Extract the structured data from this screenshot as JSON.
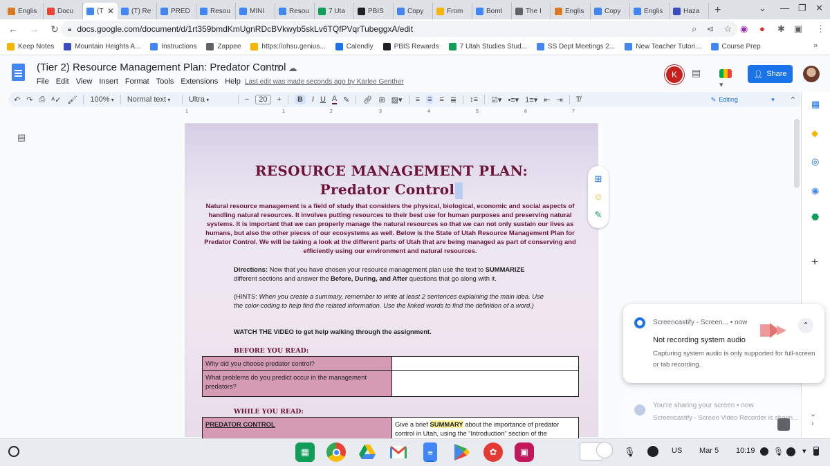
{
  "tabs": [
    {
      "label": "Englis",
      "color": "#d87a28"
    },
    {
      "label": "Docu",
      "color": "#ea4335"
    },
    {
      "label": "(T",
      "color": "#4285f4",
      "active": true
    },
    {
      "label": "(T) Re",
      "color": "#4285f4"
    },
    {
      "label": "PRED",
      "color": "#4285f4"
    },
    {
      "label": "Resou",
      "color": "#4285f4"
    },
    {
      "label": "MINI",
      "color": "#4285f4"
    },
    {
      "label": "Resou",
      "color": "#4285f4"
    },
    {
      "label": "7 Uta",
      "color": "#0f9d58"
    },
    {
      "label": "PBIS",
      "color": "#202124"
    },
    {
      "label": "Copy",
      "color": "#4285f4"
    },
    {
      "label": "From",
      "color": "#f4b400"
    },
    {
      "label": "Bomt",
      "color": "#4285f4"
    },
    {
      "label": "The I",
      "color": "#5f6368"
    },
    {
      "label": "Englis",
      "color": "#d87a28"
    },
    {
      "label": "Copy",
      "color": "#4285f4"
    },
    {
      "label": "Englis",
      "color": "#4285f4"
    },
    {
      "label": "Haza",
      "color": "#3c4dbf"
    }
  ],
  "new_tab_label": "+",
  "url": "docs.google.com/document/d/1rt359bmdKmUgnRDcBVkwyb5skLv6TQfPVqrTubeggxA/edit",
  "bookmarks": [
    {
      "label": "Keep Notes",
      "color": "#f4b400"
    },
    {
      "label": "Mountain Heights A...",
      "color": "#3c4dbf"
    },
    {
      "label": "Instructions",
      "color": "#4285f4"
    },
    {
      "label": "Zappee",
      "color": "#5f6368"
    },
    {
      "label": "https://ohsu.genius...",
      "color": "#f4b400"
    },
    {
      "label": "Calendly",
      "color": "#1a73e8"
    },
    {
      "label": "PBIS Rewards",
      "color": "#202124"
    },
    {
      "label": "7 Utah Studies Stud...",
      "color": "#0f9d58"
    },
    {
      "label": "SS Dept Meetings 2...",
      "color": "#4285f4"
    },
    {
      "label": "New Teacher Tutori...",
      "color": "#4285f4"
    },
    {
      "label": "Course Prep",
      "color": "#4285f4"
    }
  ],
  "doc": {
    "title": "(Tier 2) Resource Management Plan: Predator Control",
    "last_edit": "Last edit was made seconds ago by Karlee Genther",
    "menus": [
      "File",
      "Edit",
      "View",
      "Insert",
      "Format",
      "Tools",
      "Extensions",
      "Help"
    ],
    "avatar_letter": "K",
    "share_label": "Share"
  },
  "toolbar": {
    "zoom": "100%",
    "style": "Normal text",
    "font": "Ultra",
    "size": "20",
    "mode": "Editing"
  },
  "ruler": [
    "1",
    "1",
    "2",
    "3",
    "4",
    "5",
    "6",
    "7"
  ],
  "content": {
    "heading_line1": "RESOURCE MANAGEMENT PLAN:",
    "heading_line2": "Predator Control",
    "intro": "Natural resource management is a field of study that considers the physical, biological, economic and social aspects of handling natural resources. It involves putting resources to their best use for human purposes and preserving natural systems. It is important that we can properly manage the natural resources so that we can not only sustain our lives as humans, but also the other pieces of our ecosystems as well. Below is the State of Utah Resource Management Plan for Predator Control. We will be taking a look at the different parts of Utah that are being managed as part of conserving and efficiently using our environment and natural resources.",
    "directions_label": "Directions:",
    "directions_text1": " Now that you have chosen your resource management plan use the text to ",
    "directions_bold": "SUMMARIZE",
    "directions_text2": " different sections and answer the ",
    "directions_bold2": "Before, During, and After",
    "directions_text3": " questions that go along with it.",
    "hints_prefix": "(HINTS: ",
    "hints": "When you create a summary, remember to write at least 2 sentences explaining the main idea. Use the color-coding to help find the related information. Use the linked words to find the definition of a word.)",
    "watch": "WATCH THE VIDEO to get help walking through the assignment.",
    "before_heading": "BEFORE YOU READ:",
    "before_rows": [
      "Why did you choose predator control?",
      "What problems do you predict occur in the management predators?"
    ],
    "while_heading": "WHILE YOU READ:",
    "while_header": "PREDATOR CONTROL",
    "while_prompt_1": "Give a brief ",
    "while_prompt_bold": "SUMMARY",
    "while_prompt_2": " about the importance of predator control in Utah, using the “Introduction” section of the"
  },
  "notification": {
    "source": "Screencastify - Screen... • now",
    "title": "Not recording system audio",
    "body": "Capturing system audio is only supported for full-screen or tab recording."
  },
  "notification2": {
    "source": "You're sharing your screen • now",
    "body": "Screencastify - Screen Video Recorder is sharin..."
  },
  "shelf": {
    "region": "US",
    "date": "Mar 5",
    "time": "10:19"
  }
}
